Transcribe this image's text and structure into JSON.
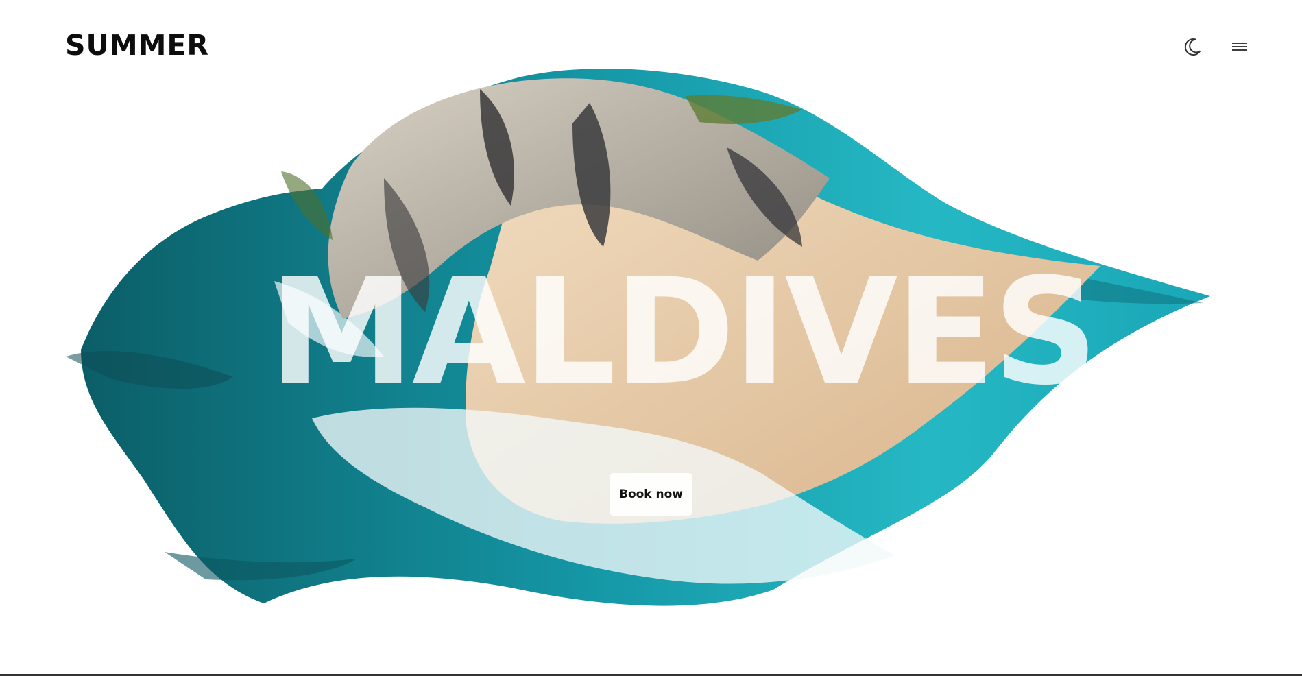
{
  "header": {
    "brand": "SUMMER",
    "theme_toggle_icon": "moon-icon",
    "menu_icon": "hamburger-menu-icon"
  },
  "hero": {
    "title": "MALDIVES",
    "cta_label": "Book now",
    "image_subject": "aerial beach with rocks and turquoise sea in brush-stroke mask"
  },
  "colors": {
    "background": "#ffffff",
    "text": "#0d0d0d",
    "sea": "#16a7b5",
    "deep_sea": "#0b5f69",
    "sand": "#e7c8a5",
    "rock": "#b9b0a2"
  }
}
